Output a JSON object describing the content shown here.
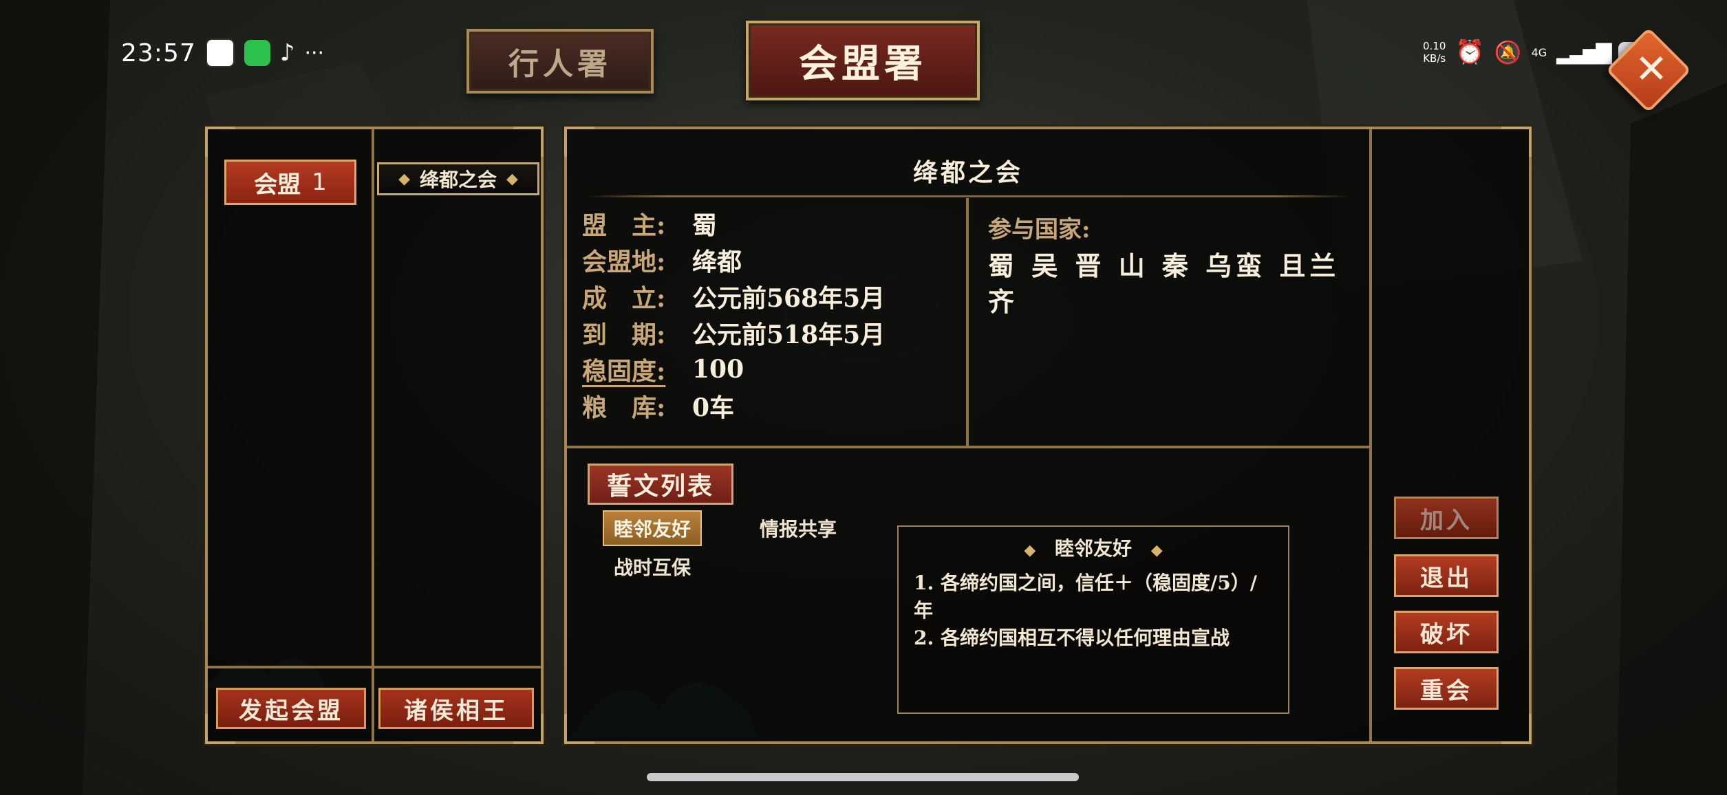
{
  "status_bar": {
    "time": "23:57",
    "apps": [
      "qq-icon",
      "wechat-icon",
      "tiktok-icon"
    ],
    "more": "···",
    "net_speed_value": "0.10",
    "net_speed_unit": "KB/s",
    "signal": "4G",
    "battery": "25"
  },
  "tabs": [
    {
      "label": "行人署",
      "active": false
    },
    {
      "label": "会盟署",
      "active": true
    }
  ],
  "left_panel": {
    "alliance_label": "会盟",
    "alliance_number": "1",
    "meeting": "绛都之会",
    "footer_buttons": [
      "发起会盟",
      "诸侯相王"
    ]
  },
  "detail": {
    "title": "绛都之会",
    "fields": [
      {
        "label": "盟　主:",
        "value": "蜀"
      },
      {
        "label": "会盟地:",
        "value": "绛都"
      },
      {
        "label": "成　立:",
        "value": "公元前568年5月"
      },
      {
        "label": "到　期:",
        "value": "公元前518年5月"
      },
      {
        "label": "稳固度:",
        "value": "100"
      },
      {
        "label": "粮　库:",
        "value": "0车"
      }
    ],
    "countries_label": "参与国家:",
    "countries": "蜀 吴 晋 山 秦 乌蛮 且兰 齐"
  },
  "oath": {
    "title": "誓文列表",
    "items": [
      "睦邻友好",
      "情报共享",
      "战时互保"
    ],
    "selected": "睦邻友好",
    "detail_title": "睦邻友好",
    "detail_lines": [
      "1. 各缔约国之间，信任＋（稳固度/5）/年",
      "2. 各缔约国相互不得以任何理由宣战"
    ]
  },
  "actions": [
    "加入",
    "退出",
    "破坏",
    "重会"
  ],
  "colors": {
    "accent_red": "#a5321c",
    "gold_border": "#a88a55",
    "label_gold": "#c9a777"
  }
}
